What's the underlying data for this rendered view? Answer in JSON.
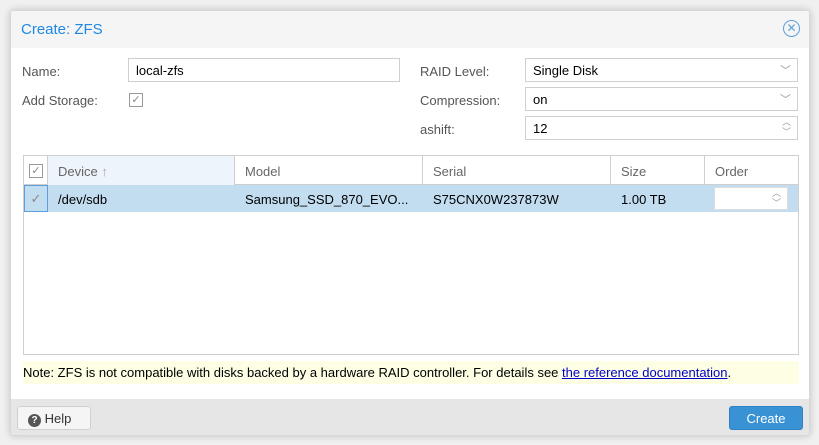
{
  "title": "Create: ZFS",
  "form": {
    "name_label": "Name:",
    "name_value": "local-zfs",
    "add_storage_label": "Add Storage:",
    "raid_label": "RAID Level:",
    "raid_value": "Single Disk",
    "compression_label": "Compression:",
    "compression_value": "on",
    "ashift_label": "ashift:",
    "ashift_value": "12"
  },
  "grid": {
    "columns": [
      "Device",
      "Model",
      "Serial",
      "Size",
      "Order"
    ],
    "rows": [
      {
        "device": "/dev/sdb",
        "model": "Samsung_SSD_870_EVO...",
        "serial": "S75CNX0W237873W",
        "size": "1.00 TB",
        "order": ""
      }
    ]
  },
  "note": {
    "text": "Note: ZFS is not compatible with disks backed by a hardware RAID controller. For details see ",
    "link": "the reference documentation",
    "end": "."
  },
  "footer": {
    "help": "Help",
    "create": "Create"
  },
  "colors": {
    "accent": "#1e88e5",
    "selected_row": "#c2dcf0",
    "create_button": "#3892d4"
  }
}
